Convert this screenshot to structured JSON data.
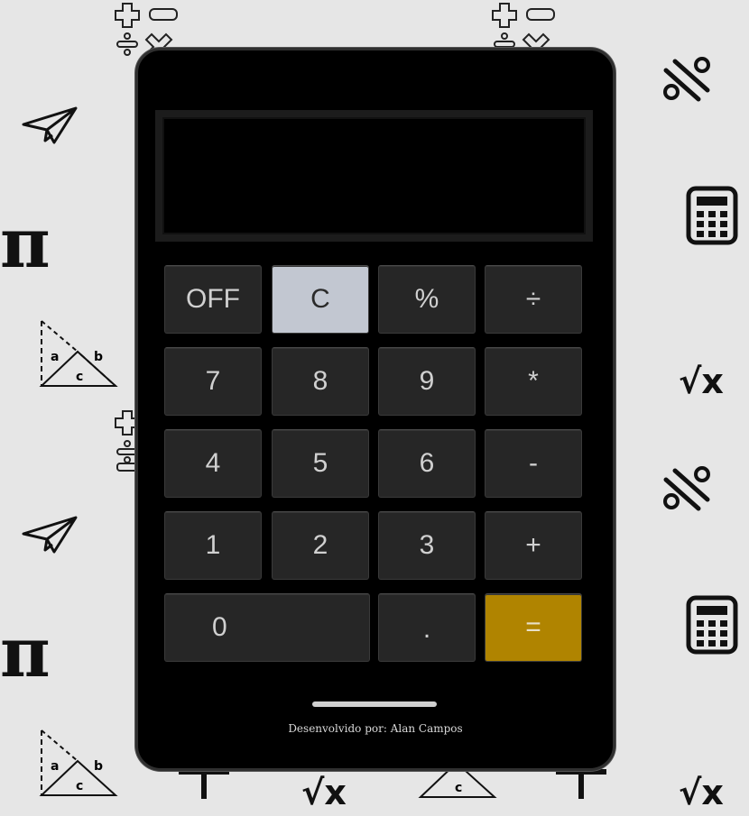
{
  "display": {
    "value": ""
  },
  "keys": [
    {
      "id": "off",
      "label": "OFF"
    },
    {
      "id": "clear",
      "label": "C"
    },
    {
      "id": "percent",
      "label": "%"
    },
    {
      "id": "divide",
      "label": "÷"
    },
    {
      "id": "7",
      "label": "7"
    },
    {
      "id": "8",
      "label": "8"
    },
    {
      "id": "9",
      "label": "9"
    },
    {
      "id": "multiply",
      "label": "*"
    },
    {
      "id": "4",
      "label": "4"
    },
    {
      "id": "5",
      "label": "5"
    },
    {
      "id": "6",
      "label": "6"
    },
    {
      "id": "minus",
      "label": "-"
    },
    {
      "id": "1",
      "label": "1"
    },
    {
      "id": "2",
      "label": "2"
    },
    {
      "id": "3",
      "label": "3"
    },
    {
      "id": "plus",
      "label": "+"
    },
    {
      "id": "0",
      "label": "0"
    },
    {
      "id": "decimal",
      "label": "."
    },
    {
      "id": "equals",
      "label": "="
    }
  ],
  "footer": {
    "credit": "Desenvolvido por: Alan Campos"
  },
  "background_icons": {
    "pi": "π",
    "sqrt": "√x",
    "a": "a",
    "b": "b",
    "c": "c"
  },
  "colors": {
    "background": "#e6e6e6",
    "device": "#000000",
    "key": "#262626",
    "clear_key": "#c2c7d1",
    "equals_key": "#b08400"
  }
}
